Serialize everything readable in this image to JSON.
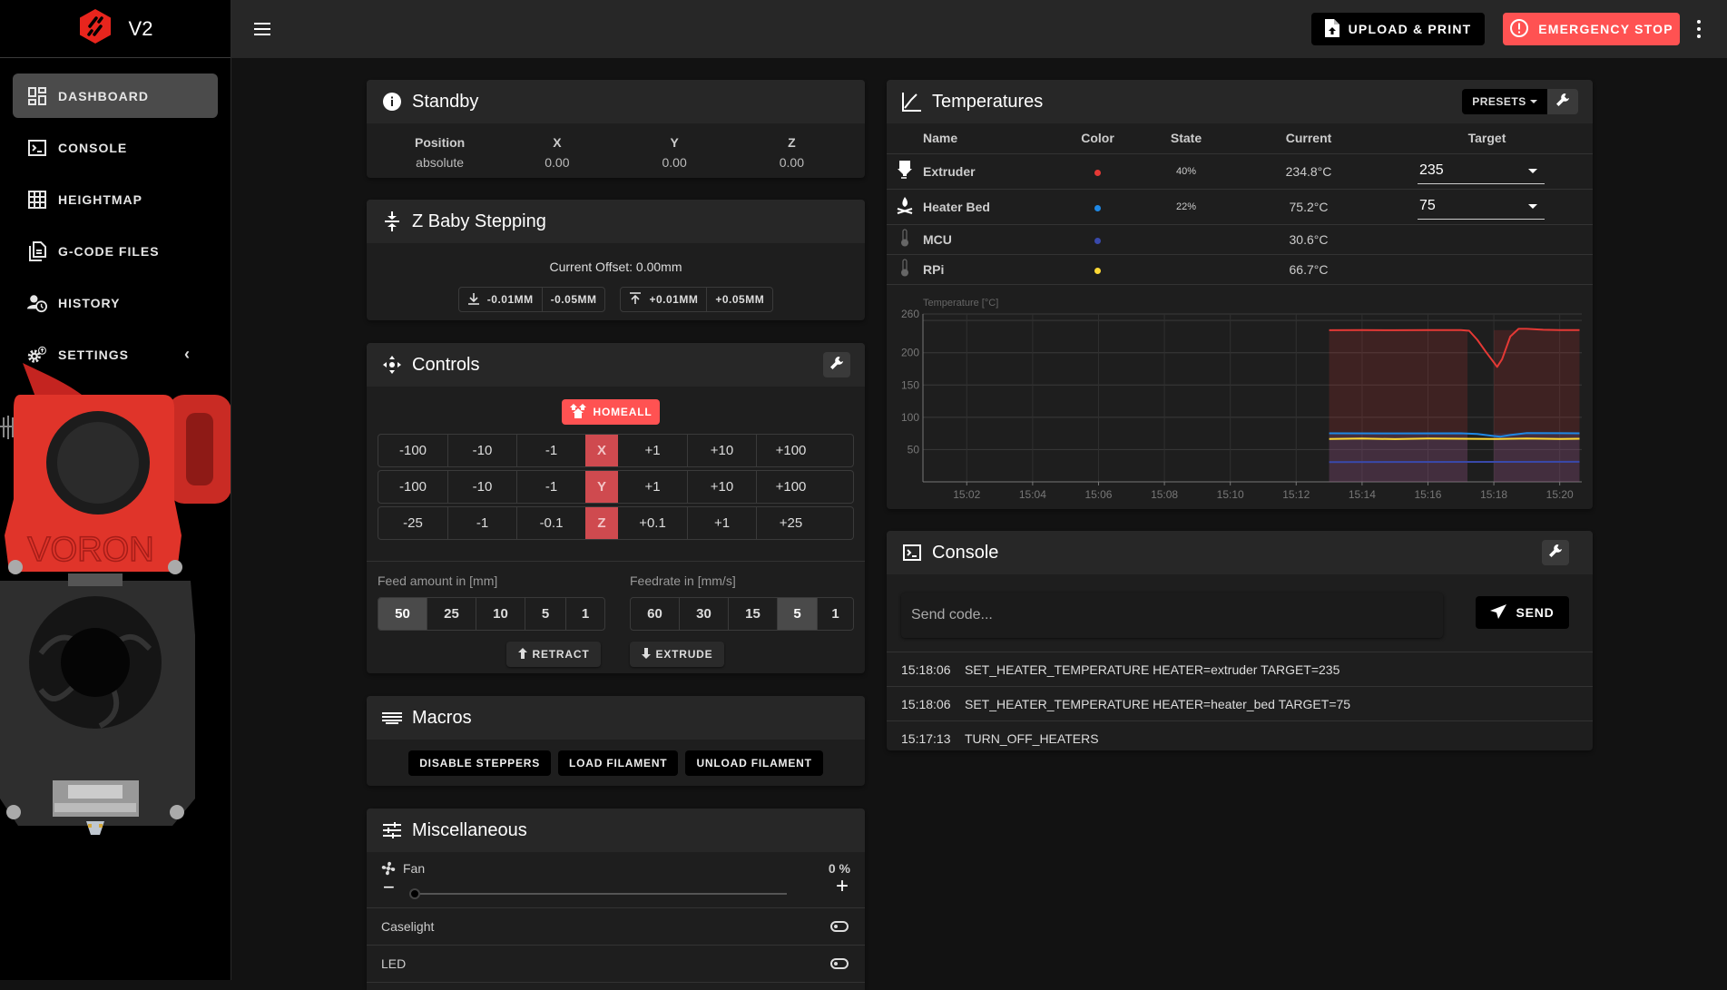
{
  "app": {
    "title": "V2"
  },
  "sidebar": {
    "items": [
      {
        "label": "DASHBOARD",
        "icon": "dashboard-icon",
        "active": true
      },
      {
        "label": "CONSOLE",
        "icon": "console-icon"
      },
      {
        "label": "HEIGHTMAP",
        "icon": "grid-icon"
      },
      {
        "label": "G-CODE FILES",
        "icon": "files-icon"
      },
      {
        "label": "HISTORY",
        "icon": "history-icon"
      },
      {
        "label": "SETTINGS",
        "icon": "settings-icon"
      }
    ],
    "printhead_text": "VORON"
  },
  "header": {
    "upload_label": "UPLOAD & PRINT",
    "estop_label": "EMERGENCY STOP"
  },
  "standby": {
    "title": "Standby",
    "headers": [
      "Position",
      "X",
      "Y",
      "Z"
    ],
    "values": [
      "absolute",
      "0.00",
      "0.00",
      "0.00"
    ]
  },
  "babystep": {
    "title": "Z Baby Stepping",
    "offset": "Current Offset: 0.00mm",
    "down": [
      "-0.01MM",
      "-0.05MM"
    ],
    "up": [
      "+0.01MM",
      "+0.05MM"
    ]
  },
  "controls": {
    "title": "Controls",
    "home_label": "HOMEALL",
    "rows": [
      {
        "axis": "X",
        "neg": [
          "-100",
          "-10",
          "-1"
        ],
        "pos": [
          "+1",
          "+10",
          "+100"
        ]
      },
      {
        "axis": "Y",
        "neg": [
          "-100",
          "-10",
          "-1"
        ],
        "pos": [
          "+1",
          "+10",
          "+100"
        ]
      },
      {
        "axis": "Z",
        "neg": [
          "-25",
          "-1",
          "-0.1"
        ],
        "pos": [
          "+0.1",
          "+1",
          "+25"
        ]
      }
    ],
    "feed_label": "Feed amount in [mm]",
    "feed_options": [
      "50",
      "25",
      "10",
      "5",
      "1"
    ],
    "feed_selected": "50",
    "feedrate_label": "Feedrate in [mm/s]",
    "feedrate_options": [
      "60",
      "30",
      "15",
      "5",
      "1"
    ],
    "feedrate_selected": "5",
    "retract_label": "RETRACT",
    "extrude_label": "EXTRUDE"
  },
  "macros": {
    "title": "Macros",
    "buttons": [
      "DISABLE STEPPERS",
      "LOAD FILAMENT",
      "UNLOAD FILAMENT"
    ]
  },
  "misc": {
    "title": "Miscellaneous",
    "fan_label": "Fan",
    "fan_value": "0 %",
    "fan_fraction": 0,
    "caselight_label": "Caselight",
    "caselight_on": false,
    "led_label": "LED",
    "led_on": false
  },
  "temperatures": {
    "title": "Temperatures",
    "presets_label": "PRESETS",
    "columns": [
      "Name",
      "Color",
      "State",
      "Current",
      "Target"
    ],
    "rows": [
      {
        "name": "Extruder",
        "icon": "extruder-icon",
        "color": "#e53935",
        "state": "40%",
        "current": "234.8°C",
        "target": "235"
      },
      {
        "name": "Heater Bed",
        "icon": "heater-bed-icon",
        "color": "#1e88e5",
        "state": "22%",
        "current": "75.2°C",
        "target": "75"
      },
      {
        "name": "MCU",
        "icon": "thermometer-icon",
        "color": "#3949ab",
        "state": "",
        "current": "30.6°C",
        "target": null
      },
      {
        "name": "RPi",
        "icon": "thermometer-icon",
        "color": "#fdd835",
        "state": "",
        "current": "66.7°C",
        "target": null
      }
    ]
  },
  "chart_data": {
    "type": "line",
    "title": "",
    "ylabel": "Temperature [°C]",
    "xlabel": "",
    "ylim": [
      0,
      260
    ],
    "yticks": [
      50,
      100,
      150,
      200,
      260
    ],
    "xlim_minutes": [
      0.67,
      20.67
    ],
    "xtick_labels": [
      "15:02",
      "15:04",
      "15:06",
      "15:08",
      "15:10",
      "15:12",
      "15:14",
      "15:16",
      "15:18",
      "15:20"
    ],
    "xtick_minutes": [
      2,
      4,
      6,
      8,
      10,
      12,
      14,
      16,
      18,
      20
    ],
    "grid": true,
    "series": [
      {
        "name": "Extruder",
        "color": "#e53935",
        "x_minutes": [
          13.0,
          14.0,
          15.0,
          16.0,
          17.0,
          17.25,
          17.5,
          17.75,
          18.0,
          18.1,
          18.25,
          18.5,
          18.75,
          19.0,
          19.5,
          20.0,
          20.6
        ],
        "values": [
          234.8,
          235,
          234.8,
          235,
          235,
          234,
          220,
          202,
          185,
          178,
          190,
          225,
          237,
          237,
          235.5,
          235,
          235
        ]
      },
      {
        "name": "Heater Bed",
        "color": "#1e88e5",
        "x_minutes": [
          13.0,
          15.0,
          17.0,
          17.5,
          18.0,
          18.2,
          18.5,
          19.0,
          20.0,
          20.6
        ],
        "values": [
          75.2,
          75,
          75.2,
          74,
          71,
          70,
          72.5,
          75.5,
          75.3,
          75.2
        ]
      },
      {
        "name": "MCU",
        "color": "#3949ab",
        "x_minutes": [
          13.0,
          20.6
        ],
        "values": [
          30.6,
          31
        ]
      },
      {
        "name": "RPi",
        "color": "#fdd835",
        "x_minutes": [
          13.0,
          14.0,
          15.0,
          16.0,
          17.0,
          18.0,
          19.0,
          20.0,
          20.6
        ],
        "values": [
          66.5,
          67,
          66.2,
          67,
          66.7,
          66.3,
          67,
          66.5,
          66.7
        ]
      }
    ],
    "target_bands": [
      {
        "name": "Extruder target",
        "color": "#e53935",
        "value": 235,
        "segments_minutes": [
          [
            13.0,
            17.2
          ],
          [
            18.0,
            20.6
          ]
        ]
      },
      {
        "name": "Heater Bed target",
        "color": "#5c6bc0",
        "value": 75,
        "segments_minutes": [
          [
            13.0,
            17.2
          ],
          [
            18.0,
            20.6
          ]
        ]
      }
    ]
  },
  "console": {
    "title": "Console",
    "placeholder": "Send code...",
    "send_label": "SEND",
    "lines": [
      {
        "time": "15:18:06",
        "text": "SET_HEATER_TEMPERATURE HEATER=extruder TARGET=235"
      },
      {
        "time": "15:18:06",
        "text": "SET_HEATER_TEMPERATURE HEATER=heater_bed TARGET=75"
      },
      {
        "time": "15:17:13",
        "text": "TURN_OFF_HEATERS"
      }
    ]
  }
}
